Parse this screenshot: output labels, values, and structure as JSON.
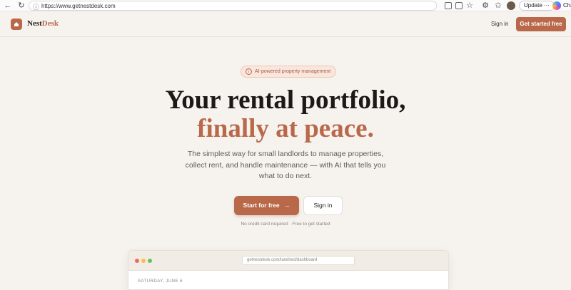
{
  "browser": {
    "url": "https://www.getnestdesk.com",
    "update_label": "Update",
    "copilot_label": "Cha"
  },
  "header": {
    "brand_part1": "Nest",
    "brand_part2": "Desk",
    "signin_label": "Sign in",
    "cta_label": "Get started free"
  },
  "hero": {
    "badge_text": "AI-powered property management",
    "headline_line1": "Your rental portfolio,",
    "headline_line2": "finally at peace.",
    "subtitle": "The simplest way for small landlords to manage properties, collect rent, and handle maintenance — with AI that tells you what to do next.",
    "primary_button": "Start for free",
    "primary_arrow": "→",
    "secondary_button": "Sign in",
    "fine_print": "No credit card required · Free to get started"
  },
  "preview": {
    "url": "getnestdesk.com/landlord/dashboard",
    "date_label": "SATURDAY, JUNE 6"
  },
  "colors": {
    "accent": "#b9694a",
    "background": "#f6f3ef",
    "text": "#1c1a18"
  },
  "icons": {
    "logo": "house-icon",
    "badge": "info-icon",
    "arrow": "arrow-right-icon"
  }
}
